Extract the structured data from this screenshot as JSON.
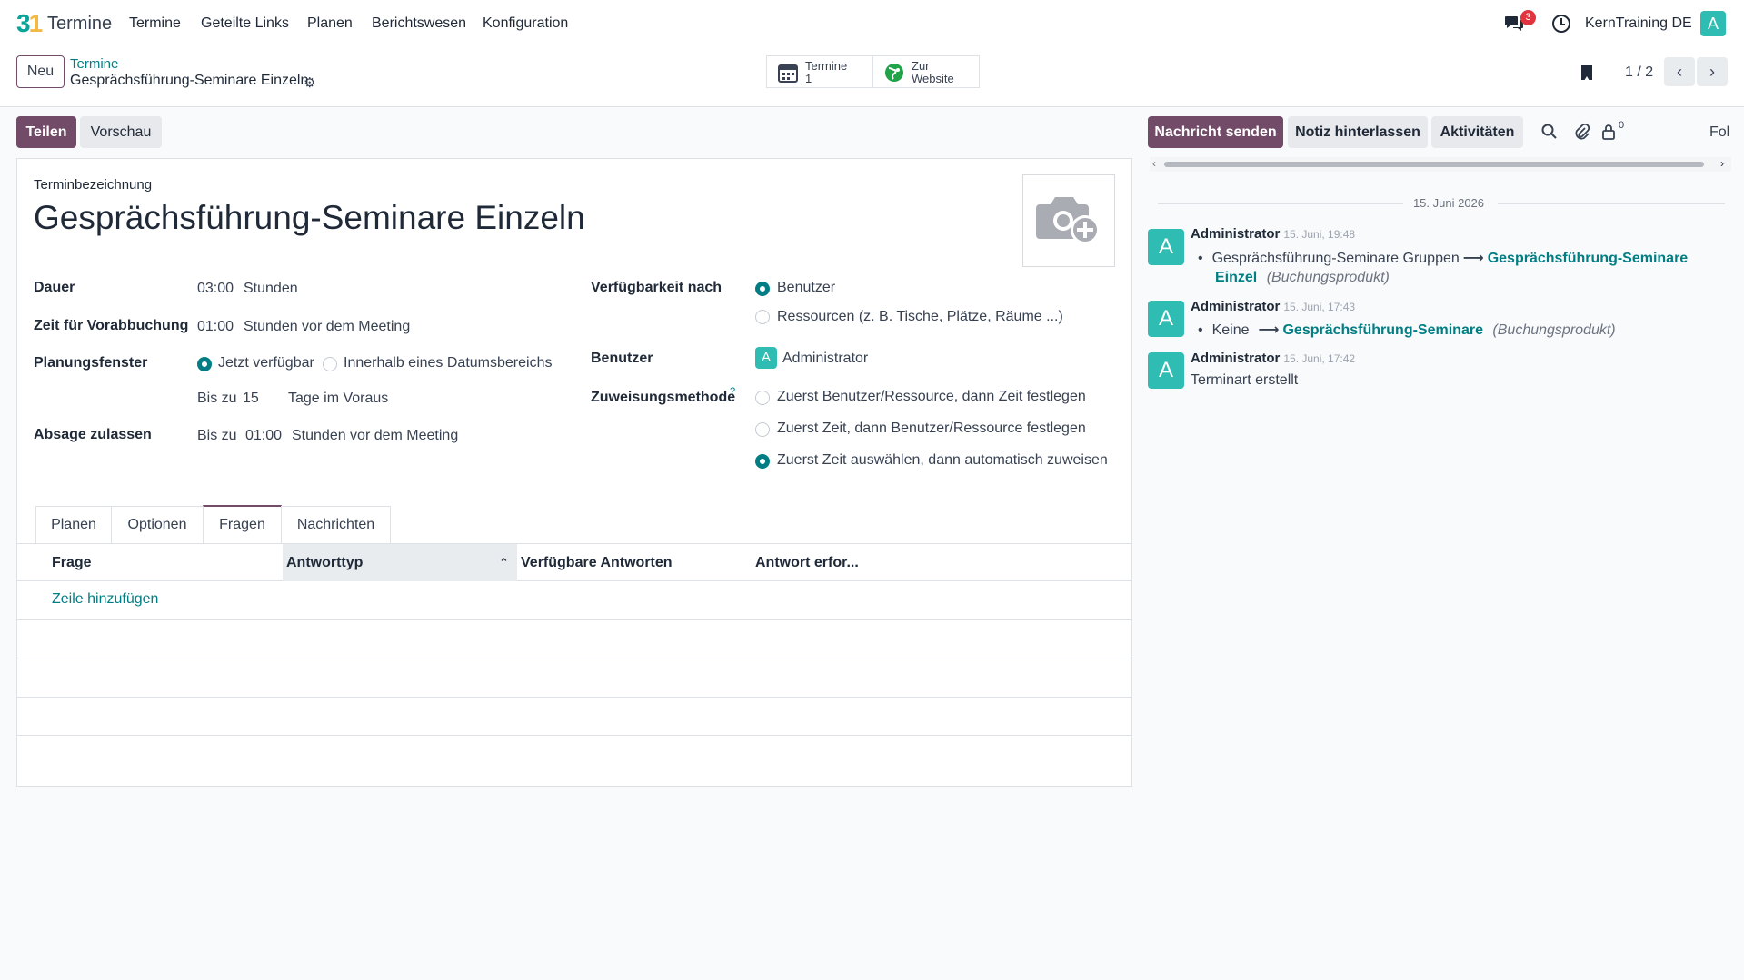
{
  "navbar": {
    "app_name": "Termine",
    "menu": [
      "Termine",
      "Geteilte Links",
      "Planen",
      "Berichtswesen",
      "Konfiguration"
    ],
    "notification_count": "3",
    "company": "KernTraining DE",
    "user_initial": "A"
  },
  "control_panel": {
    "new_button": "Neu",
    "breadcrumb_parent": "Termine",
    "breadcrumb_current": "Gesprächsführung-Seminare Einzeln",
    "smart_buttons": [
      {
        "label": "Termine",
        "value": "1"
      },
      {
        "label": "Zur",
        "value": "Website"
      }
    ],
    "pager": "1 / 2"
  },
  "actions": {
    "share": "Teilen",
    "preview": "Vorschau"
  },
  "form": {
    "name_label": "Terminbezeichnung",
    "name_value": "Gesprächsführung-Seminare Einzeln",
    "duration_label": "Dauer",
    "duration_value": "03:00",
    "duration_unit": "Stunden",
    "lead_time_label": "Zeit für Vorabbuchung",
    "lead_time_value": "01:00",
    "lead_time_unit": "Stunden vor dem Meeting",
    "window_label": "Planungsfenster",
    "window_option_now": "Jetzt verfügbar",
    "window_option_range": "Innerhalb eines Datumsbereichs",
    "window_until_prefix": "Bis zu",
    "window_until_value": "15",
    "window_until_unit": "Tage im Voraus",
    "cancel_label": "Absage zulassen",
    "cancel_prefix": "Bis zu",
    "cancel_value": "01:00",
    "cancel_unit": "Stunden vor dem Meeting",
    "availability_label": "Verfügbarkeit nach",
    "availability_users": "Benutzer",
    "availability_resources": "Ressourcen (z. B. Tische, Plätze, Räume ...)",
    "users_label": "Benutzer",
    "user_initial": "A",
    "user_name": "Administrator",
    "assignment_label": "Zuweisungsmethode",
    "assignment_help": "?",
    "assignment_options": [
      "Zuerst Benutzer/Ressource, dann Zeit festlegen",
      "Zuerst Zeit, dann Benutzer/Ressource festlegen",
      "Zuerst Zeit auswählen, dann automatisch zuweisen"
    ]
  },
  "tabs": [
    "Planen",
    "Optionen",
    "Fragen",
    "Nachrichten"
  ],
  "list": {
    "headers": [
      "Frage",
      "Antworttyp",
      "Verfügbare Antworten",
      "Antwort erfor..."
    ],
    "add_line": "Zeile hinzufügen"
  },
  "chatter": {
    "send_message": "Nachricht senden",
    "log_note": "Notiz hinterlassen",
    "activities": "Aktivitäten",
    "follower_count": "0",
    "follow": "Fol",
    "date_separator": "15. Juni 2026",
    "messages": [
      {
        "author": "Administrator",
        "time": "15. Juni, 19:48",
        "old_value": "Gesprächsführung-Seminare Gruppen",
        "new_value_line1": "Gesprächsführung-Seminare",
        "new_value_line2": "Einzel",
        "field": "(Buchungsprodukt)"
      },
      {
        "author": "Administrator",
        "time": "15. Juni, 17:43",
        "old_value": "Keine",
        "new_value": "Gesprächsführung-Seminare",
        "field": "(Buchungsprodukt)"
      },
      {
        "author": "Administrator",
        "time": "15. Juni, 17:42",
        "body": "Terminart erstellt"
      }
    ]
  }
}
